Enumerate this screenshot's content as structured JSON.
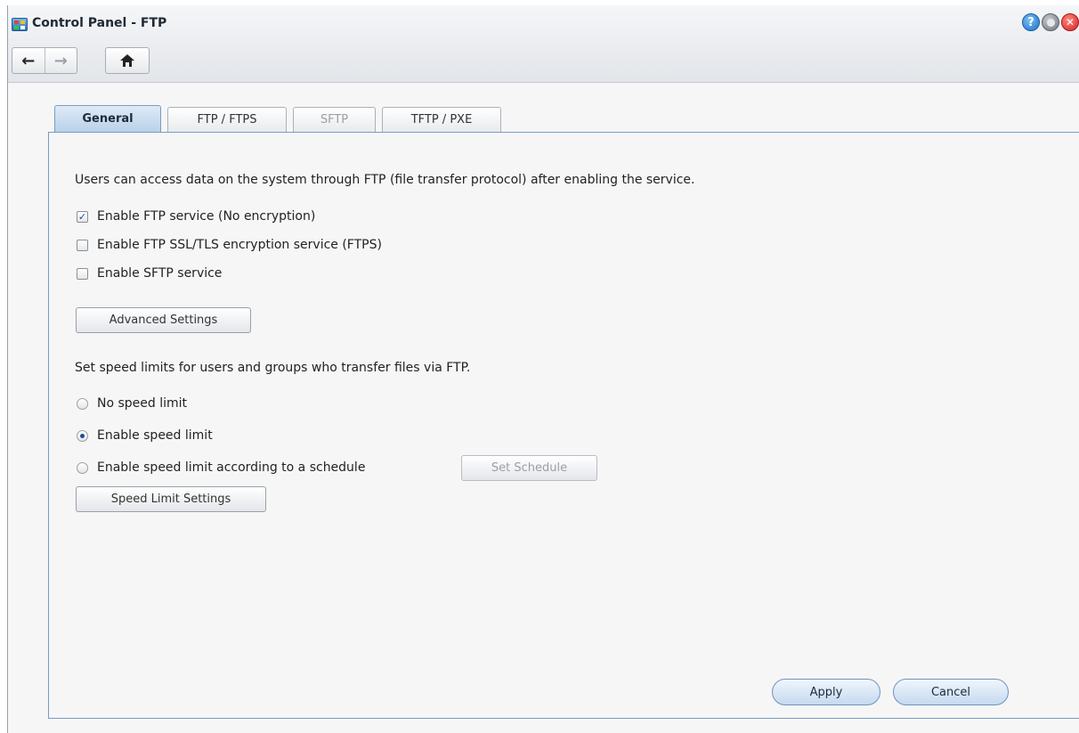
{
  "window": {
    "title": "Control Panel - FTP"
  },
  "nav": {
    "back": "←",
    "forward": "→"
  },
  "tabs": [
    {
      "label": "General",
      "state": "active"
    },
    {
      "label": "FTP / FTPS",
      "state": "normal"
    },
    {
      "label": "SFTP",
      "state": "disabled"
    },
    {
      "label": "TFTP / PXE",
      "state": "normal"
    }
  ],
  "general": {
    "description": "Users can access data on the system through FTP (file transfer protocol) after enabling the service.",
    "services": [
      {
        "label": "Enable FTP service (No encryption)",
        "checked": true
      },
      {
        "label": "Enable FTP SSL/TLS encryption service (FTPS)",
        "checked": false
      },
      {
        "label": "Enable SFTP service",
        "checked": false
      }
    ],
    "advanced_settings_label": "Advanced Settings",
    "speed_description": "Set speed limits for users and groups who transfer files via FTP.",
    "speed_options": [
      {
        "label": "No speed limit",
        "selected": false
      },
      {
        "label": "Enable speed limit",
        "selected": true
      },
      {
        "label": "Enable speed limit according to a schedule",
        "selected": false
      }
    ],
    "set_schedule_label": "Set Schedule",
    "speed_limit_settings_label": "Speed Limit Settings"
  },
  "footer": {
    "apply_label": "Apply",
    "cancel_label": "Cancel"
  },
  "colors": {
    "accent": "#7a9cc2",
    "check": "#1a4f9c"
  }
}
